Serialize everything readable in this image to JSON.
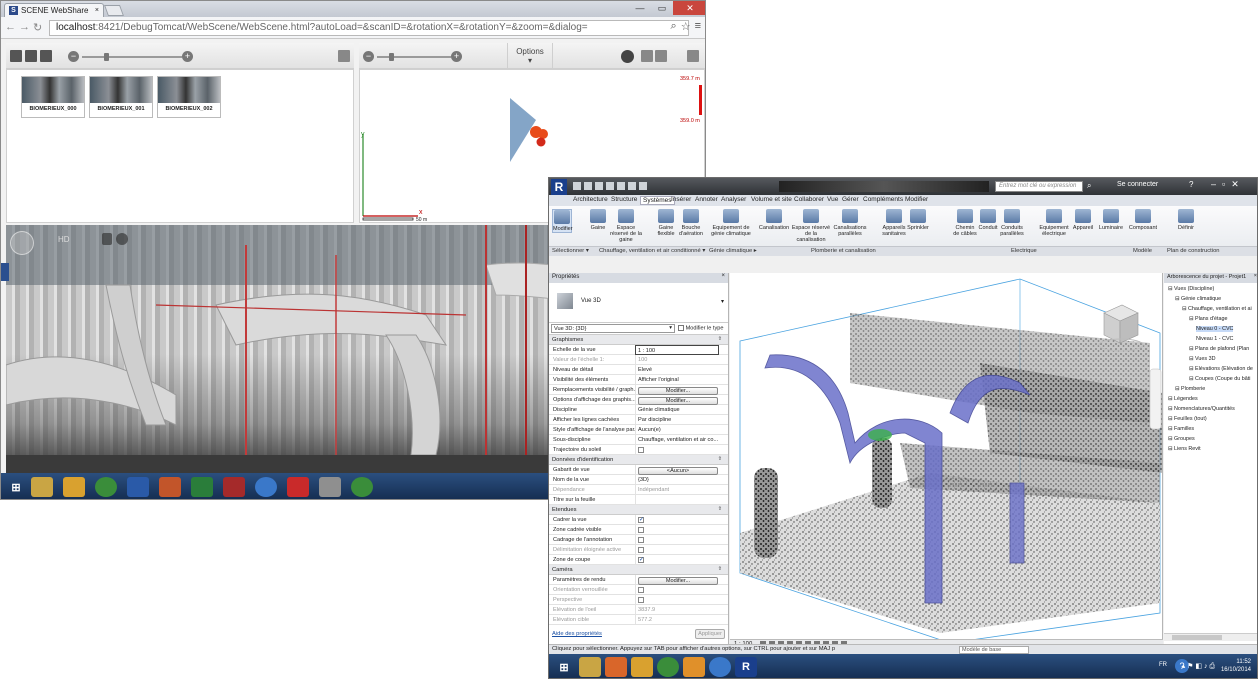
{
  "browser": {
    "tab_title": "SCENE WebShare",
    "url_host": "localhost",
    "url_rest": ":8421/DebugTomcat/WebScene/WebScene.html?autoLoad=&scanID=&rotationX=&rotationY=&zoom=&dialog=",
    "options_label": "Options",
    "scans": [
      "BIOMERIEUX_000",
      "BIOMERIEUX_001",
      "BIOMERIEUX_002"
    ],
    "elevation_top": "359.7 m",
    "elevation_bottom": "359.0 m",
    "axis_y": "y",
    "axis_x": "x",
    "scale_label": "50 m",
    "pano_hd_label": "HD"
  },
  "revit": {
    "search_placeholder": "Entrez mot clé ou expression",
    "connect_label": "Se connecter",
    "tabs": [
      "Architecture",
      "Structure",
      "Systèmes",
      "Insérer",
      "Annoter",
      "Analyser",
      "Volume et site",
      "Collaborer",
      "Vue",
      "Gérer",
      "Compléments",
      "Modifier"
    ],
    "ribbon_tools": [
      {
        "label": "Modifier"
      },
      {
        "label": "Gaine"
      },
      {
        "label": "Espace réservé de la gaine"
      },
      {
        "label": "Gaine flexible"
      },
      {
        "label": "Bouche d'aération"
      },
      {
        "label": "Equipement de génie climatique"
      },
      {
        "label": "Canalisation"
      },
      {
        "label": "Espace réservé de la canalisation"
      },
      {
        "label": "Canalisations parallèles"
      },
      {
        "label": "Appareils sanitaires"
      },
      {
        "label": "Sprinkler"
      },
      {
        "label": "Chemin de câbles"
      },
      {
        "label": "Conduit"
      },
      {
        "label": "Conduits parallèles"
      },
      {
        "label": "Equipement électrique"
      },
      {
        "label": "Appareil"
      },
      {
        "label": "Luminaire"
      },
      {
        "label": "Composant"
      },
      {
        "label": "Définir"
      }
    ],
    "ribbon_groups": [
      "Sélectionner ▾",
      "Chauffage, ventilation et air conditionné ▾",
      "Génie climatique ▸",
      "Plomberie et canalisation",
      "Electrique",
      "Modèle",
      "Plan de construction"
    ],
    "properties": {
      "title": "Propriétés",
      "type_name": "Vue 3D",
      "view_selector": "Vue 3D: {3D}",
      "edit_type": "Modifier le type",
      "sections": [
        {
          "name": "Graphismes",
          "rows": [
            {
              "k": "Echelle de la vue",
              "v": "1 : 100",
              "kind": "input"
            },
            {
              "k": "Valeur de l'échelle   1:",
              "v": "100",
              "kind": "dis"
            },
            {
              "k": "Niveau de détail",
              "v": "Elevé"
            },
            {
              "k": "Visibilité des éléments",
              "v": "Afficher l'original"
            },
            {
              "k": "Remplacements visibilité / graph...",
              "v": "Modifier...",
              "kind": "btn"
            },
            {
              "k": "Options d'affichage des graphis...",
              "v": "Modifier...",
              "kind": "btn"
            },
            {
              "k": "Discipline",
              "v": "Génie climatique"
            },
            {
              "k": "Afficher les lignes cachées",
              "v": "Par discipline"
            },
            {
              "k": "Style d'affichage de l'analyse par...",
              "v": "Aucun(e)"
            },
            {
              "k": "Sous-discipline",
              "v": "Chauffage, ventilation et air co..."
            },
            {
              "k": "Trajectoire du soleil",
              "v": "",
              "kind": "cb",
              "checked": false
            }
          ]
        },
        {
          "name": "Données d'identification",
          "rows": [
            {
              "k": "Gabarit de vue",
              "v": "<Aucun>",
              "kind": "btn"
            },
            {
              "k": "Nom de la vue",
              "v": "{3D}"
            },
            {
              "k": "Dépendance",
              "v": "Indépendant",
              "kind": "dis"
            },
            {
              "k": "Titre sur la feuille",
              "v": ""
            }
          ]
        },
        {
          "name": "Etendues",
          "rows": [
            {
              "k": "Cadrer la vue",
              "v": "",
              "kind": "cb",
              "checked": true
            },
            {
              "k": "Zone cadrée visible",
              "v": "",
              "kind": "cb",
              "checked": false
            },
            {
              "k": "Cadrage de l'annotation",
              "v": "",
              "kind": "cb",
              "checked": false
            },
            {
              "k": "Délimitation éloignée active",
              "v": "",
              "kind": "cbdis",
              "checked": false
            },
            {
              "k": "Zone de coupe",
              "v": "",
              "kind": "cb",
              "checked": true
            }
          ]
        },
        {
          "name": "Caméra",
          "rows": [
            {
              "k": "Paramètres de rendu",
              "v": "Modifier...",
              "kind": "btn"
            },
            {
              "k": "Orientation verrouillée",
              "v": "",
              "kind": "cbdis",
              "checked": false
            },
            {
              "k": "Perspective",
              "v": "",
              "kind": "cbdis",
              "checked": false
            },
            {
              "k": "Elévation de l'oeil",
              "v": "3837.9",
              "kind": "dis"
            },
            {
              "k": "Elévation cible",
              "v": "577.2",
              "kind": "dis"
            }
          ]
        }
      ],
      "help_link": "Aide des propriétés",
      "apply_label": "Appliquer"
    },
    "browser_tree": {
      "title": "Arborescence du projet - Projet1",
      "nodes": [
        {
          "label": "Vues (Discipline)",
          "indent": 0,
          "sel": false
        },
        {
          "label": "Génie climatique",
          "indent": 1,
          "sel": false
        },
        {
          "label": "Chauffage, ventilation et ai",
          "indent": 2,
          "sel": false
        },
        {
          "label": "Plans d'étage",
          "indent": 3,
          "sel": false
        },
        {
          "label": "Niveau 0 - CVC",
          "indent": 4,
          "sel": true
        },
        {
          "label": "Niveau 1 - CVC",
          "indent": 4,
          "sel": false
        },
        {
          "label": "Plans de plafond (Plan",
          "indent": 3,
          "sel": false
        },
        {
          "label": "Vues 3D",
          "indent": 3,
          "sel": false
        },
        {
          "label": "Elévations (Elévation de",
          "indent": 3,
          "sel": false
        },
        {
          "label": "Coupes (Coupe du bâti",
          "indent": 3,
          "sel": false
        },
        {
          "label": "Plomberie",
          "indent": 1,
          "sel": false
        },
        {
          "label": "Légendes",
          "indent": 0,
          "sel": false
        },
        {
          "label": "Nomenclatures/Quantités",
          "indent": 0,
          "sel": false
        },
        {
          "label": "Feuilles (tout)",
          "indent": 0,
          "sel": false
        },
        {
          "label": "Familles",
          "indent": 0,
          "sel": false
        },
        {
          "label": "Groupes",
          "indent": 0,
          "sel": false
        },
        {
          "label": "Liens Revit",
          "indent": 0,
          "sel": false
        }
      ]
    },
    "view_scale": "1 : 100",
    "status_text": "Cliquez pour sélectionner. Appuyez sur TAB pour afficher d'autres options, sur CTRL pour ajouter et sur MAJ p",
    "model_label": "Modèle de base",
    "taskbar_lang": "FR",
    "clock_time": "11:52",
    "clock_date": "16/10/2014"
  },
  "colors": {
    "taskbar": "#1f3b63",
    "duct": "#6a70c9",
    "pointcloud": "#333333",
    "crop_box": "#4aa3e0"
  }
}
